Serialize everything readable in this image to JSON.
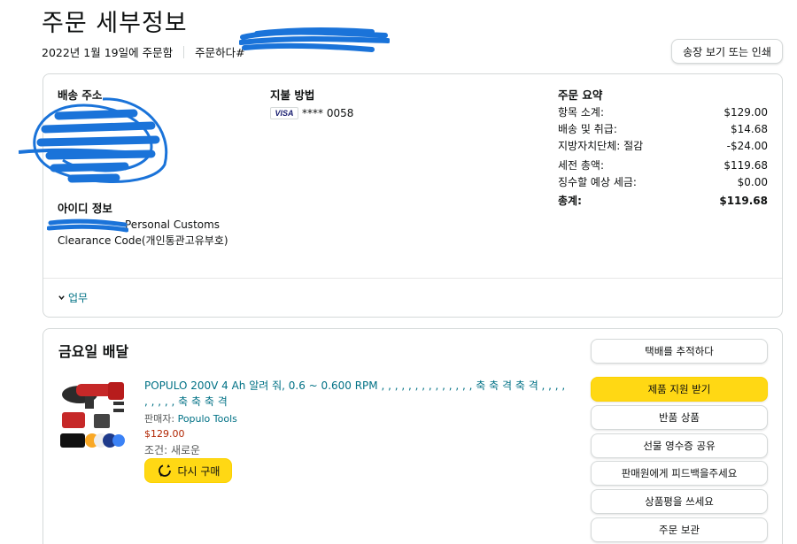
{
  "header": {
    "title": "주문 세부정보",
    "order_date": "2022년 1월 19일에 주문함",
    "order_number_label": "주문하다#",
    "invoice_button": "송장 보기 또는 인쇄"
  },
  "shipping": {
    "label": "배송 주소",
    "id_label": "아이디 정보",
    "id_line1": "Personal Customs",
    "id_line2": "Clearance Code(개인통관고유부호)"
  },
  "payment": {
    "label": "지불 방법",
    "card_brand": "VISA",
    "card_number": "**** 0058"
  },
  "summary": {
    "label": "주문 요약",
    "rows": [
      {
        "label": "항목 소계:",
        "value": "$129.00"
      },
      {
        "label": "배송 및 취급:",
        "value": "$14.68"
      },
      {
        "label": "지방자치단체: 절감",
        "value": "-$24.00"
      },
      {
        "label": "세전 총액:",
        "value": "$119.68"
      },
      {
        "label": "징수할 예상 세금:",
        "value": "$0.00"
      }
    ],
    "total_label": "총계:",
    "total_value": "$119.68"
  },
  "toggle": {
    "label": "업무"
  },
  "delivery": {
    "title": "금요일 배달",
    "product_title": "POPULO 200V 4 Ah 알려 줘, 0.6 ~ 0.600 RPM , , , , , , , , , , , , , , 축 축 격 축 격 , , , , , , , , , 축 축 축 격",
    "seller_label": "판매자:",
    "seller_name": "Populo Tools",
    "price": "$129.00",
    "condition": "조건: 새로운",
    "buy_again": "다시 구매",
    "actions": [
      "택배를 추적하다",
      "제품 지원 받기",
      "반품 상품",
      "선물 영수증 공유",
      "판매원에게 피드백을주세요",
      "상품평을 쓰세요",
      "주문 보관"
    ]
  },
  "colors": {
    "link": "#007185",
    "primary_button": "#ffd814",
    "price": "#b12704",
    "redaction": "#1a73d9"
  }
}
